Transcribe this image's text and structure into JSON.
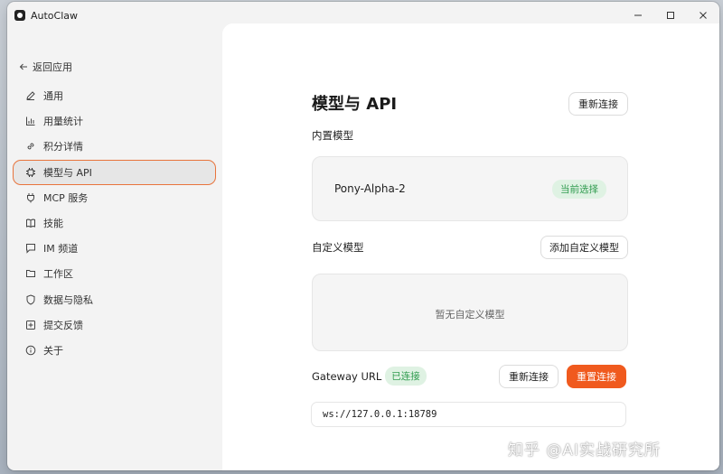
{
  "window": {
    "title": "AutoClaw"
  },
  "sidebar": {
    "back_label": "返回应用",
    "items": [
      {
        "label": "通用",
        "icon": "pencil-icon",
        "active": false
      },
      {
        "label": "用量统计",
        "icon": "bar-chart-icon",
        "active": false
      },
      {
        "label": "积分详情",
        "icon": "link-icon",
        "active": false
      },
      {
        "label": "模型与 API",
        "icon": "chip-icon",
        "active": true
      },
      {
        "label": "MCP 服务",
        "icon": "plug-icon",
        "active": false
      },
      {
        "label": "技能",
        "icon": "book-icon",
        "active": false
      },
      {
        "label": "IM 频道",
        "icon": "chat-icon",
        "active": false
      },
      {
        "label": "工作区",
        "icon": "folder-icon",
        "active": false
      },
      {
        "label": "数据与隐私",
        "icon": "shield-icon",
        "active": false
      },
      {
        "label": "提交反馈",
        "icon": "feedback-icon",
        "active": false
      },
      {
        "label": "关于",
        "icon": "info-icon",
        "active": false
      }
    ]
  },
  "main": {
    "title": "模型与 API",
    "reconnect_top_label": "重新连接",
    "builtin": {
      "label": "内置模型",
      "model_name": "Pony-Alpha-2",
      "badge": "当前选择"
    },
    "custom": {
      "label": "自定义模型",
      "add_button": "添加自定义模型",
      "empty_text": "暂无自定义模型"
    },
    "gateway": {
      "label": "Gateway URL",
      "status_badge": "已连接",
      "reconnect_label": "重新连接",
      "reset_label": "重置连接",
      "url": "ws://127.0.0.1:18789"
    }
  },
  "watermark": "知乎 @AI实战研究所",
  "colors": {
    "accent": "#f05a1e",
    "active_border": "#e8743c",
    "success_bg": "#dff2e3",
    "success_text": "#2f9b4e"
  }
}
